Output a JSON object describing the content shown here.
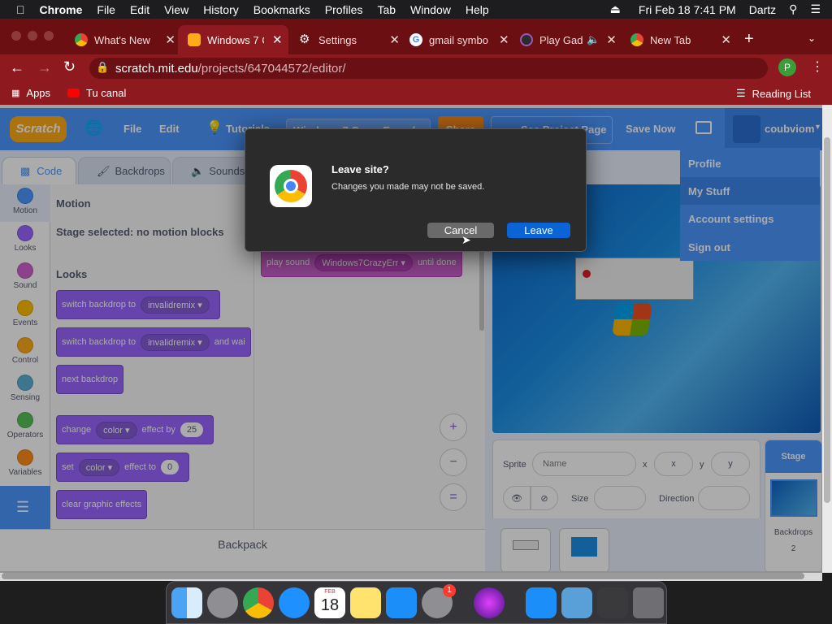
{
  "macos": {
    "app_name": "Chrome",
    "menus": [
      "File",
      "Edit",
      "View",
      "History",
      "Bookmarks",
      "Profiles",
      "Tab",
      "Window",
      "Help"
    ],
    "datetime": "Fri Feb 18  7:41 PM",
    "user": "Dartz"
  },
  "browser": {
    "tabs": [
      {
        "label": "What's New",
        "icon": "chrome-icon"
      },
      {
        "label": "Windows 7 C",
        "icon": "scratch-icon"
      },
      {
        "label": "Settings",
        "icon": "gear-icon"
      },
      {
        "label": "gmail symbo",
        "icon": "google-icon"
      },
      {
        "label": "Play Gad",
        "icon": "play-icon"
      },
      {
        "label": "New Tab",
        "icon": "chrome-icon"
      }
    ],
    "url_host": "scratch.mit.edu",
    "url_path": "/projects/647044572/editor/",
    "bookmarks": {
      "apps": "Apps",
      "channel": "Tu canal",
      "reading_list": "Reading List"
    },
    "profile_initial": "P"
  },
  "scratch": {
    "menu": {
      "file": "File",
      "edit": "Edit",
      "tutorials": "Tutorials",
      "project_title": "Windows 7 Crazy Error (",
      "share": "Share",
      "see_project": "See Project Page",
      "save_now": "Save Now",
      "username": "coubviom"
    },
    "tabs": {
      "code": "Code",
      "backdrops": "Backdrops",
      "sounds": "Sounds"
    },
    "categories": [
      {
        "label": "Motion",
        "color": "#4c97ff"
      },
      {
        "label": "Looks",
        "color": "#9966ff"
      },
      {
        "label": "Sound",
        "color": "#cf63cf"
      },
      {
        "label": "Events",
        "color": "#ffbf00"
      },
      {
        "label": "Control",
        "color": "#ffab19"
      },
      {
        "label": "Sensing",
        "color": "#5cb1d6"
      },
      {
        "label": "Operators",
        "color": "#59c059"
      },
      {
        "label": "Variables",
        "color": "#ff8c1a"
      }
    ],
    "palette": {
      "motion_header": "Motion",
      "motion_note": "Stage selected: no motion blocks",
      "looks_header": "Looks",
      "blocks": {
        "b1": {
          "text": "switch backdrop to",
          "slot": "invalidremix"
        },
        "b2": {
          "text": "switch backdrop to",
          "slot": "invalidremix",
          "suffix": "and wai"
        },
        "b3": {
          "text": "next backdrop"
        },
        "b4": {
          "text": "change",
          "slot": "color",
          "mid": "effect by",
          "num": "25"
        },
        "b5": {
          "text": "set",
          "slot": "color",
          "mid": "effect to",
          "num": "0"
        },
        "b6": {
          "text": "clear graphic effects"
        }
      }
    },
    "workspace_block": {
      "text": "play sound",
      "slot": "Windows7CrazyErr",
      "suffix": "until done"
    },
    "backpack": "Backpack",
    "sprite_info": {
      "sprite_label": "Sprite",
      "name_placeholder": "Name",
      "x_label": "x",
      "x_placeholder": "x",
      "y_label": "y",
      "y_placeholder": "y",
      "size_label": "Size",
      "direction_label": "Direction"
    },
    "stage_panel": {
      "title": "Stage",
      "backdrops_label": "Backdrops",
      "backdrops_count": "2"
    },
    "account_menu": [
      "Profile",
      "My Stuff",
      "Account settings",
      "Sign out"
    ]
  },
  "dialog": {
    "title": "Leave site?",
    "message": "Changes you made may not be saved.",
    "cancel": "Cancel",
    "leave": "Leave"
  },
  "dock": {
    "calendar_month": "FEB",
    "calendar_day": "18",
    "settings_badge": "1"
  }
}
